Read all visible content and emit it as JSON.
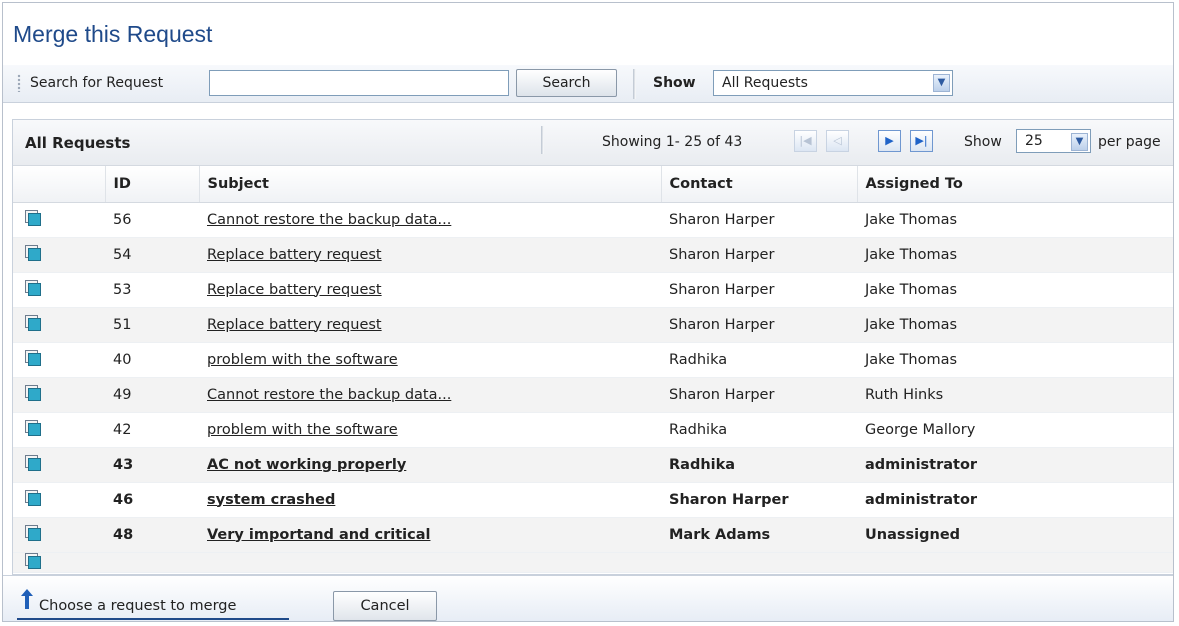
{
  "title": "Merge this Request",
  "search": {
    "label": "Search for Request",
    "value": "",
    "button": "Search"
  },
  "filter": {
    "label": "Show",
    "value": "All Requests"
  },
  "list": {
    "title": "All Requests",
    "showing": "Showing 1- 25 of 43",
    "show_label": "Show",
    "per_page_value": "25",
    "per_page_label": "per page"
  },
  "columns": [
    "ID",
    "Subject",
    "Contact",
    "Assigned To"
  ],
  "rows": [
    {
      "id": "56",
      "subject": "Cannot restore the backup data...",
      "contact": "Sharon Harper",
      "assigned": "Jake Thomas",
      "bold": false
    },
    {
      "id": "54",
      "subject": "Replace battery request",
      "contact": "Sharon Harper",
      "assigned": "Jake Thomas",
      "bold": false
    },
    {
      "id": "53",
      "subject": "Replace battery request",
      "contact": "Sharon Harper",
      "assigned": "Jake Thomas",
      "bold": false
    },
    {
      "id": "51",
      "subject": "Replace battery request",
      "contact": "Sharon Harper",
      "assigned": "Jake Thomas",
      "bold": false
    },
    {
      "id": "40",
      "subject": "problem with the software",
      "contact": "Radhika",
      "assigned": "Jake Thomas",
      "bold": false
    },
    {
      "id": "49",
      "subject": "Cannot restore the backup data...",
      "contact": "Sharon Harper",
      "assigned": "Ruth Hinks",
      "bold": false
    },
    {
      "id": "42",
      "subject": "problem with the software",
      "contact": "Radhika",
      "assigned": "George Mallory",
      "bold": false
    },
    {
      "id": "43",
      "subject": "AC not working properly",
      "contact": "Radhika",
      "assigned": "administrator",
      "bold": true
    },
    {
      "id": "46",
      "subject": "system crashed",
      "contact": "Sharon Harper",
      "assigned": "administrator",
      "bold": true
    },
    {
      "id": "48",
      "subject": "Very importand and critical",
      "contact": "Mark Adams",
      "assigned": "Unassigned",
      "bold": true
    }
  ],
  "footer": {
    "choose_label": "Choose a request to merge",
    "cancel": "Cancel"
  }
}
